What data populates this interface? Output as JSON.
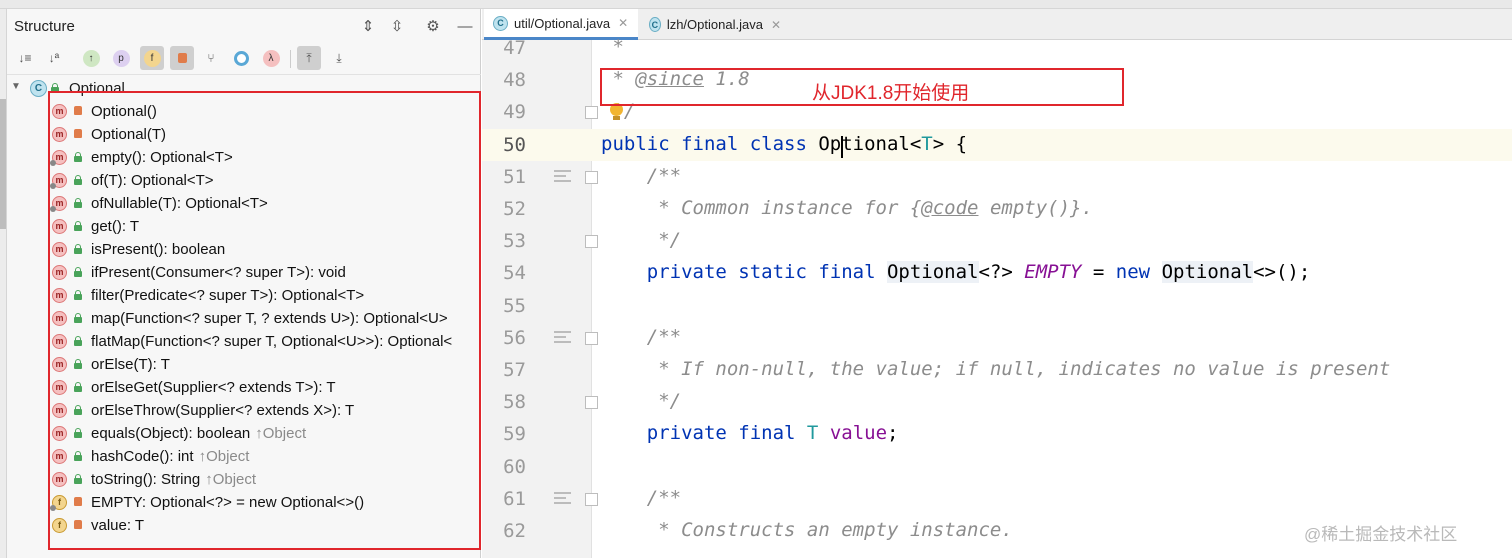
{
  "structure": {
    "title": "Structure",
    "root_label": "Optional",
    "items": [
      {
        "label": "Optional()",
        "kind": "m",
        "vis": "private",
        "static": false,
        "override": ""
      },
      {
        "label": "Optional(T)",
        "kind": "m",
        "vis": "private",
        "static": false,
        "override": ""
      },
      {
        "label": "empty(): Optional<T>",
        "kind": "m",
        "vis": "public",
        "static": true,
        "override": ""
      },
      {
        "label": "of(T): Optional<T>",
        "kind": "m",
        "vis": "public",
        "static": true,
        "override": ""
      },
      {
        "label": "ofNullable(T): Optional<T>",
        "kind": "m",
        "vis": "public",
        "static": true,
        "override": ""
      },
      {
        "label": "get(): T",
        "kind": "m",
        "vis": "public",
        "static": false,
        "override": ""
      },
      {
        "label": "isPresent(): boolean",
        "kind": "m",
        "vis": "public",
        "static": false,
        "override": ""
      },
      {
        "label": "ifPresent(Consumer<? super T>): void",
        "kind": "m",
        "vis": "public",
        "static": false,
        "override": ""
      },
      {
        "label": "filter(Predicate<? super T>): Optional<T>",
        "kind": "m",
        "vis": "public",
        "static": false,
        "override": ""
      },
      {
        "label": "map(Function<? super T, ? extends U>): Optional<U>",
        "kind": "m",
        "vis": "public",
        "static": false,
        "override": ""
      },
      {
        "label": "flatMap(Function<? super T, Optional<U>>): Optional<",
        "kind": "m",
        "vis": "public",
        "static": false,
        "override": ""
      },
      {
        "label": "orElse(T): T",
        "kind": "m",
        "vis": "public",
        "static": false,
        "override": ""
      },
      {
        "label": "orElseGet(Supplier<? extends T>): T",
        "kind": "m",
        "vis": "public",
        "static": false,
        "override": ""
      },
      {
        "label": "orElseThrow(Supplier<? extends X>): T",
        "kind": "m",
        "vis": "public",
        "static": false,
        "override": ""
      },
      {
        "label": "equals(Object): boolean",
        "kind": "m",
        "vis": "public",
        "static": false,
        "override": "↑Object"
      },
      {
        "label": "hashCode(): int",
        "kind": "m",
        "vis": "public",
        "static": false,
        "override": "↑Object"
      },
      {
        "label": "toString(): String",
        "kind": "m",
        "vis": "public",
        "static": false,
        "override": "↑Object"
      },
      {
        "label": "EMPTY: Optional<?> = new Optional<>()",
        "kind": "f",
        "vis": "private",
        "static": true,
        "override": ""
      },
      {
        "label": "value: T",
        "kind": "f",
        "vis": "private",
        "static": false,
        "override": ""
      }
    ],
    "toolbar_glyphs": [
      "p",
      "f",
      "λ"
    ]
  },
  "tabs": [
    {
      "label": "util/Optional.java",
      "active": true
    },
    {
      "label": "lzh/Optional.java",
      "active": false
    }
  ],
  "annotation": {
    "text": "从JDK1.8开始使用"
  },
  "code": {
    "current_line": "50",
    "lines": [
      {
        "num": "47",
        "gutter": "",
        "parts": [
          {
            "t": " *",
            "c": "cmt"
          }
        ]
      },
      {
        "num": "48",
        "gutter": "",
        "parts": [
          {
            "t": " * ",
            "c": "cmt"
          },
          {
            "t": "@since",
            "c": "tag"
          },
          {
            "t": " 1.8",
            "c": "cmt"
          }
        ]
      },
      {
        "num": "49",
        "gutter": "fold",
        "parts": [
          {
            "t": " */",
            "c": "cmt"
          }
        ]
      },
      {
        "num": "50",
        "gutter": "",
        "parts": [
          {
            "t": "public final class ",
            "c": "kw"
          },
          {
            "t": "Optional<",
            "c": ""
          },
          {
            "t": "T",
            "c": "tp"
          },
          {
            "t": "> {",
            "c": ""
          }
        ]
      },
      {
        "num": "51",
        "gutter": "doc",
        "parts": [
          {
            "t": "    /**",
            "c": "cmt"
          }
        ]
      },
      {
        "num": "52",
        "gutter": "",
        "parts": [
          {
            "t": "     * Common instance for {",
            "c": "cmt"
          },
          {
            "t": "@code",
            "c": "tag"
          },
          {
            "t": " empty()}.",
            "c": "cmt"
          }
        ]
      },
      {
        "num": "53",
        "gutter": "fold",
        "parts": [
          {
            "t": "     */",
            "c": "cmt"
          }
        ]
      },
      {
        "num": "54",
        "gutter": "",
        "parts": [
          {
            "t": "    private static final ",
            "c": "kw"
          },
          {
            "t": "Optional",
            "c": "hl"
          },
          {
            "t": "<?> ",
            "c": ""
          },
          {
            "t": "EMPTY",
            "c": "st"
          },
          {
            "t": " = ",
            "c": ""
          },
          {
            "t": "new ",
            "c": "kw"
          },
          {
            "t": "Optional",
            "c": "hl"
          },
          {
            "t": "<>();",
            "c": ""
          }
        ]
      },
      {
        "num": "55",
        "gutter": "",
        "parts": []
      },
      {
        "num": "56",
        "gutter": "doc",
        "parts": [
          {
            "t": "    /**",
            "c": "cmt"
          }
        ]
      },
      {
        "num": "57",
        "gutter": "",
        "parts": [
          {
            "t": "     * If non-null, the value; if null, indicates no value is present",
            "c": "cmt"
          }
        ]
      },
      {
        "num": "58",
        "gutter": "fold",
        "parts": [
          {
            "t": "     */",
            "c": "cmt"
          }
        ]
      },
      {
        "num": "59",
        "gutter": "",
        "parts": [
          {
            "t": "    private final ",
            "c": "kw"
          },
          {
            "t": "T",
            "c": "tp"
          },
          {
            "t": " ",
            "c": ""
          },
          {
            "t": "value",
            "c": "fd"
          },
          {
            "t": ";",
            "c": ""
          }
        ]
      },
      {
        "num": "60",
        "gutter": "",
        "parts": []
      },
      {
        "num": "61",
        "gutter": "doc",
        "parts": [
          {
            "t": "    /**",
            "c": "cmt"
          }
        ]
      },
      {
        "num": "62",
        "gutter": "",
        "parts": [
          {
            "t": "     * Constructs an empty instance.",
            "c": "cmt"
          }
        ]
      }
    ]
  },
  "watermark": "@稀土掘金技术社区",
  "colors": {
    "annotation_red": "#e0262c",
    "keyword_blue": "#0033b3",
    "comment_gray": "#8c8c8c",
    "static_purple": "#871094",
    "type_teal": "#20999d"
  }
}
